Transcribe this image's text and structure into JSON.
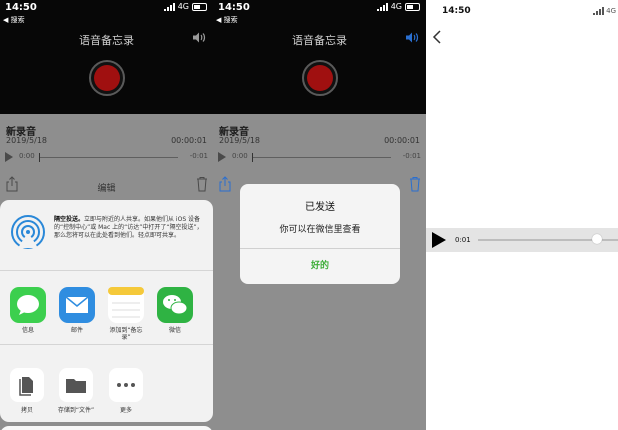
{
  "panel1": {
    "status": {
      "time": "14:50",
      "network": "4G"
    },
    "back_label": "◀ 搜索",
    "title": "语音备忘录",
    "recording": {
      "name": "新录音",
      "date": "2019/5/18",
      "duration": "00:00:01",
      "time_start": "0:00",
      "time_end": "-0:01"
    },
    "edit_label": "编辑",
    "airdrop": {
      "title": "隔空投送。",
      "description": "立即与附近的人共享。如果他们从 iOS 设备的“控制中心”或 Mac 上的“访达”中打开了“隔空投送”，那么您将可以在此处看到他们。轻点即可共享。"
    },
    "apps": [
      {
        "label": "信息",
        "icon": "messages-icon",
        "color": "#3ccf4e"
      },
      {
        "label": "邮件",
        "icon": "mail-icon",
        "color": "#2f8de0"
      },
      {
        "label": "添加到“备忘录”",
        "icon": "notes-icon",
        "color": "#ffffff"
      },
      {
        "label": "微信",
        "icon": "wechat-icon",
        "color": "#2fb343"
      }
    ],
    "actions": [
      {
        "label": "拷贝",
        "icon": "copy-icon"
      },
      {
        "label": "存储到“文件”",
        "icon": "folder-icon"
      },
      {
        "label": "更多",
        "icon": "more-icon"
      }
    ]
  },
  "panel2": {
    "status": {
      "time": "14:50",
      "network": "4G"
    },
    "back_label": "◀ 搜索",
    "title": "语音备忘录",
    "recording": {
      "name": "新录音",
      "date": "2019/5/18",
      "duration": "00:00:01",
      "time_start": "0:00",
      "time_end": "-0:01"
    },
    "alert": {
      "title": "已发送",
      "message": "你可以在微信里查看",
      "button": "好的",
      "button_color": "#3dae38"
    }
  },
  "panel3": {
    "status": {
      "time": "14:50",
      "network": "4G"
    },
    "player": {
      "time": "0:01",
      "progress": 0.85
    }
  }
}
